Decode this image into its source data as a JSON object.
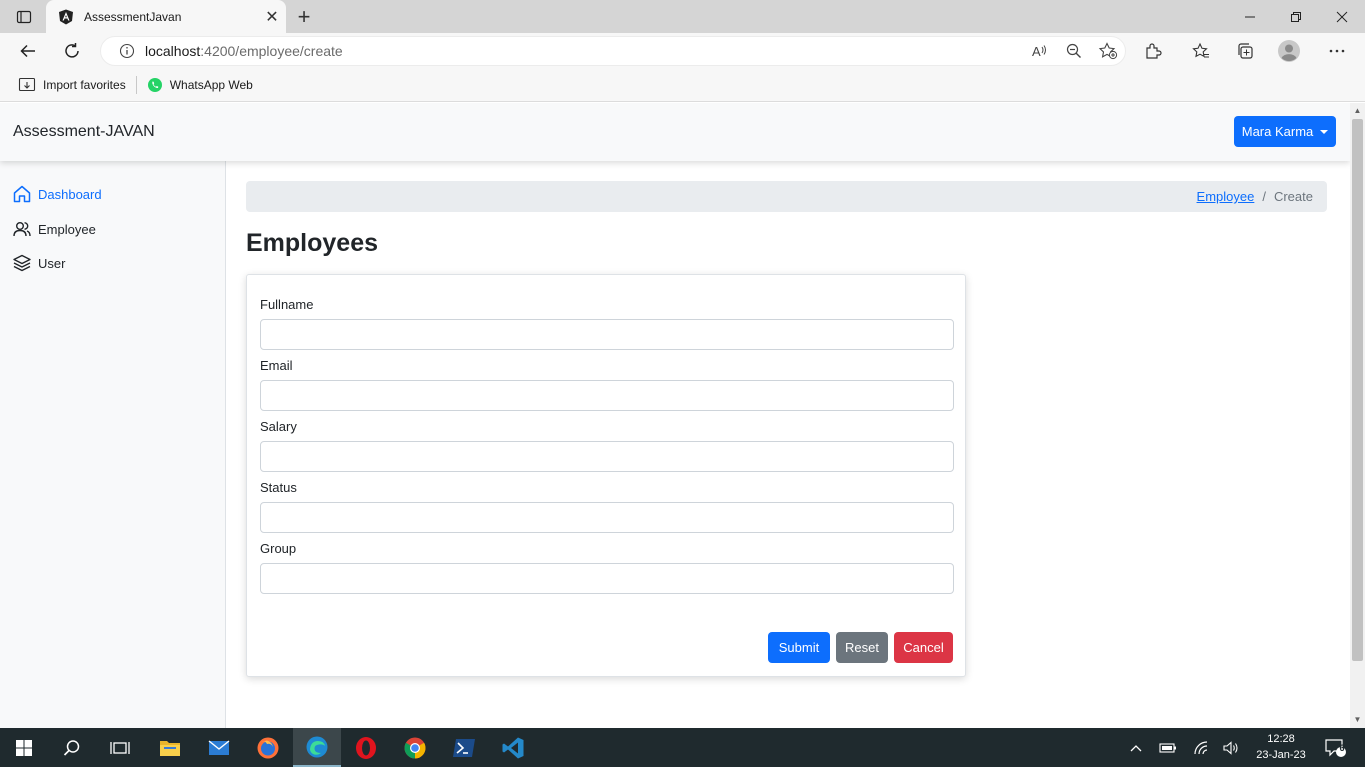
{
  "browser": {
    "tab_title": "AssessmentJavan",
    "url_host": "localhost",
    "url_path": ":4200/employee/create",
    "bookmarks": [
      {
        "label": "Import favorites"
      },
      {
        "label": "WhatsApp Web"
      }
    ]
  },
  "app": {
    "brand": "Assessment-JAVAN",
    "user_menu_label": "Mara Karma",
    "sidebar": {
      "items": [
        {
          "label": "Dashboard",
          "icon": "home-icon",
          "active": true
        },
        {
          "label": "Employee",
          "icon": "people-icon",
          "active": false
        },
        {
          "label": "User",
          "icon": "layers-icon",
          "active": false
        }
      ]
    },
    "breadcrumb": {
      "link": "Employee",
      "separator": "/",
      "current": "Create"
    },
    "page_title": "Employees",
    "form": {
      "fields": [
        {
          "label": "Fullname",
          "value": ""
        },
        {
          "label": "Email",
          "value": ""
        },
        {
          "label": "Salary",
          "value": ""
        },
        {
          "label": "Status",
          "value": ""
        },
        {
          "label": "Group",
          "value": ""
        }
      ],
      "submit_label": "Submit",
      "reset_label": "Reset",
      "cancel_label": "Cancel"
    }
  },
  "taskbar": {
    "time": "12:28",
    "date": "23-Jan-23",
    "notification_count": "6"
  },
  "colors": {
    "primary": "#0d6efd",
    "secondary": "#6c757d",
    "danger": "#dc3545",
    "taskbar": "#1f2a2e"
  }
}
